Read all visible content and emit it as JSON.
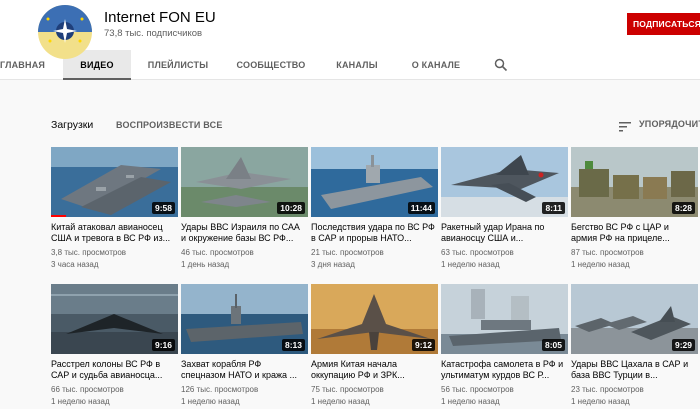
{
  "channel": {
    "name": "Internet FON EU",
    "subscribers": "73,8 тыс. подписчиков",
    "subscribe_label": "ПОДПИСАТЬСЯ"
  },
  "tabs": [
    {
      "label": "ГЛАВНАЯ"
    },
    {
      "label": "ВИДЕО"
    },
    {
      "label": "ПЛЕЙЛИСТЫ"
    },
    {
      "label": "СООБЩЕСТВО"
    },
    {
      "label": "КАНАЛЫ"
    },
    {
      "label": "О КАНАЛЕ"
    }
  ],
  "section": {
    "title": "Загрузки",
    "play_all": "ВОСПРОИЗВЕСТИ ВСЕ",
    "sort_label": "УПОРЯДОЧИТЬ"
  },
  "videos": [
    {
      "title": "Китай атаковал авианосец США и тревога в ВС РФ из...",
      "views": "3,8 тыс. просмотров",
      "age": "3 часа назад",
      "duration": "9:58",
      "watched": 0.12
    },
    {
      "title": "Удары ВВС Израиля по САА и окружение базы ВС РФ...",
      "views": "46 тыс. просмотров",
      "age": "1 день назад",
      "duration": "10:28"
    },
    {
      "title": "Последствия удара по ВС РФ в САР и прорыв НАТО...",
      "views": "21 тыс. просмотров",
      "age": "3 дня назад",
      "duration": "11:44"
    },
    {
      "title": "Ракетный удар Ирана по авианосцу США и...",
      "views": "63 тыс. просмотров",
      "age": "1 неделю назад",
      "duration": "8:11"
    },
    {
      "title": "Бегство ВС РФ с ЦАР и армия РФ на прицеле...",
      "views": "87 тыс. просмотров",
      "age": "1 неделю назад",
      "duration": "8:28"
    },
    {
      "title": "Расстрел колоны ВС РФ в САР и судьба авианосца...",
      "views": "66 тыс. просмотров",
      "age": "1 неделю назад",
      "duration": "9:16"
    },
    {
      "title": "Захват корабля РФ спецназом НАТО и кража ...",
      "views": "126 тыс. просмотров",
      "age": "1 неделю назад",
      "duration": "8:13"
    },
    {
      "title": "Армия Китая начала оккупацию РФ и ЗРК...",
      "views": "75 тыс. просмотров",
      "age": "1 неделю назад",
      "duration": "9:12"
    },
    {
      "title": "Катастрофа самолета в РФ и ультиматум курдов ВС Р...",
      "views": "56 тыс. просмотров",
      "age": "1 неделю назад",
      "duration": "8:05"
    },
    {
      "title": "Удары ВВС Цахала в САР и база ВВС Турции в...",
      "views": "23 тыс. просмотров",
      "age": "1 неделю назад",
      "duration": "9:29"
    }
  ],
  "colors": {
    "subscribe_red": "#cc0000",
    "progress_red": "#ff0000",
    "text_secondary": "#606060"
  }
}
